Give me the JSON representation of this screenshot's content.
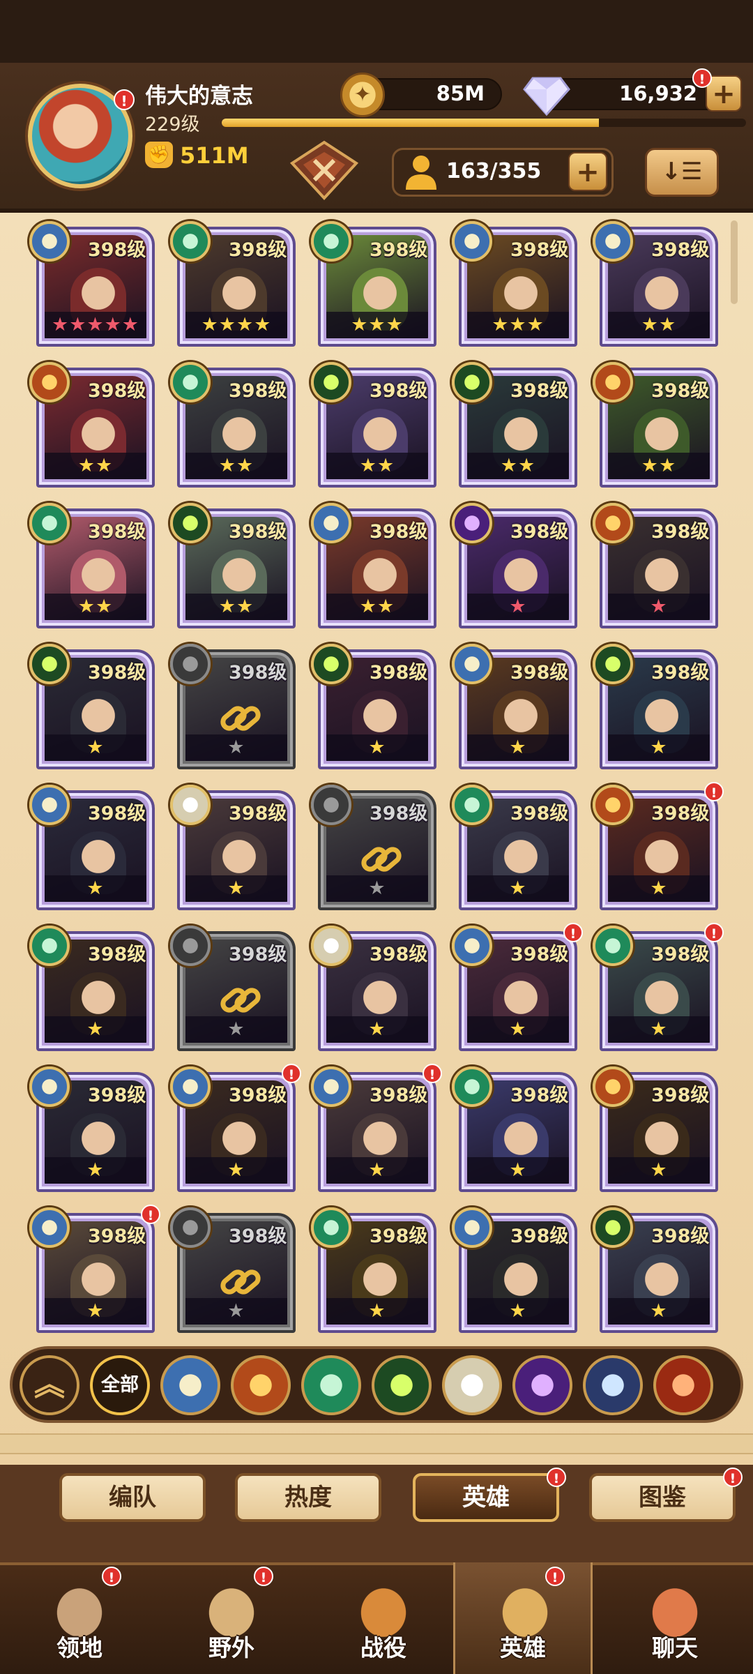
{
  "player": {
    "name": "伟大的意志",
    "level": "229级",
    "power": "511M",
    "xp_progress": 0.72
  },
  "resources": {
    "gold": "85M",
    "diamonds": "16,932",
    "plus_label": "+"
  },
  "roster": {
    "slots": "163/355",
    "plus_label": "+",
    "sort_label": "↓☰"
  },
  "colors": {
    "panel_bg": "#f3dfb9",
    "card_frame": "#5e4b8e",
    "badge_red": "#e0312b",
    "gold_text": "#ffcf3a"
  },
  "heroes": [
    {
      "level": "398级",
      "stars": "★★★★★",
      "star_color": "#f05a6c",
      "faction": "lightbearer",
      "portrait": "#7a2b2b",
      "locked": false,
      "alert": false
    },
    {
      "level": "398级",
      "stars": "★★★★",
      "star_color": "#ffd54a",
      "faction": "wilder",
      "portrait": "#4d3a2c",
      "locked": false,
      "alert": false
    },
    {
      "level": "398级",
      "stars": "★★★",
      "star_color": "#ffd54a",
      "faction": "wilder",
      "portrait": "#6b8a3a",
      "locked": false,
      "alert": false
    },
    {
      "level": "398级",
      "stars": "★★★",
      "star_color": "#ffd54a",
      "faction": "lightbearer",
      "portrait": "#6b4a22",
      "locked": false,
      "alert": false
    },
    {
      "level": "398级",
      "stars": "★★",
      "star_color": "#ffd54a",
      "faction": "lightbearer",
      "portrait": "#4a3a5a",
      "locked": false,
      "alert": false
    },
    {
      "level": "398级",
      "stars": "★★",
      "star_color": "#ffd54a",
      "faction": "mauler",
      "portrait": "#7a2a30",
      "locked": false,
      "alert": false
    },
    {
      "level": "398级",
      "stars": "★★",
      "star_color": "#ffd54a",
      "faction": "wilder",
      "portrait": "#3c4040",
      "locked": false,
      "alert": false
    },
    {
      "level": "398级",
      "stars": "★★",
      "star_color": "#ffd54a",
      "faction": "graveborn",
      "portrait": "#4b3c6a",
      "locked": false,
      "alert": false
    },
    {
      "level": "398级",
      "stars": "★★",
      "star_color": "#ffd54a",
      "faction": "graveborn",
      "portrait": "#2a3a3a",
      "locked": false,
      "alert": false
    },
    {
      "level": "398级",
      "stars": "★★",
      "star_color": "#ffd54a",
      "faction": "mauler",
      "portrait": "#3e5a2a",
      "locked": false,
      "alert": false
    },
    {
      "level": "398级",
      "stars": "★★",
      "star_color": "#ffd54a",
      "faction": "wilder",
      "portrait": "#b05a6a",
      "locked": false,
      "alert": false
    },
    {
      "level": "398级",
      "stars": "★★",
      "star_color": "#ffd54a",
      "faction": "graveborn",
      "portrait": "#5a6a5a",
      "locked": false,
      "alert": false
    },
    {
      "level": "398级",
      "stars": "★★",
      "star_color": "#ffd54a",
      "faction": "lightbearer",
      "portrait": "#7a3a2a",
      "locked": false,
      "alert": false
    },
    {
      "level": "398级",
      "stars": "★",
      "star_color": "#f05a6c",
      "faction": "hypogean",
      "portrait": "#4a2a6a",
      "locked": false,
      "alert": false
    },
    {
      "level": "398级",
      "stars": "★",
      "star_color": "#f05a6c",
      "faction": "mauler",
      "portrait": "#3a3030",
      "locked": false,
      "alert": false
    },
    {
      "level": "398级",
      "stars": "★",
      "star_color": "#ffd54a",
      "faction": "graveborn",
      "portrait": "#2a2a35",
      "locked": false,
      "alert": false
    },
    {
      "level": "398级",
      "stars": "★",
      "star_color": "#9a9a9a",
      "faction": "locked",
      "portrait": "#444444",
      "locked": true,
      "alert": false
    },
    {
      "level": "398级",
      "stars": "★",
      "star_color": "#ffd54a",
      "faction": "graveborn",
      "portrait": "#3a2030",
      "locked": false,
      "alert": false
    },
    {
      "level": "398级",
      "stars": "★",
      "star_color": "#ffd54a",
      "faction": "lightbearer",
      "portrait": "#5a3a20",
      "locked": false,
      "alert": false
    },
    {
      "level": "398级",
      "stars": "★",
      "star_color": "#ffd54a",
      "faction": "graveborn",
      "portrait": "#2a3a4a",
      "locked": false,
      "alert": false
    },
    {
      "level": "398级",
      "stars": "★",
      "star_color": "#ffd54a",
      "faction": "lightbearer",
      "portrait": "#2a2a3a",
      "locked": false,
      "alert": false
    },
    {
      "level": "398级",
      "stars": "★",
      "star_color": "#ffd54a",
      "faction": "celestial",
      "portrait": "#4a3a3a",
      "locked": false,
      "alert": false
    },
    {
      "level": "398级",
      "stars": "★",
      "star_color": "#9a9a9a",
      "faction": "locked",
      "portrait": "#444444",
      "locked": true,
      "alert": false
    },
    {
      "level": "398级",
      "stars": "★",
      "star_color": "#ffd54a",
      "faction": "wilder",
      "portrait": "#3a3a4a",
      "locked": false,
      "alert": false
    },
    {
      "level": "398级",
      "stars": "★",
      "star_color": "#ffd54a",
      "faction": "mauler",
      "portrait": "#5a2a20",
      "locked": false,
      "alert": true
    },
    {
      "level": "398级",
      "stars": "★",
      "star_color": "#ffd54a",
      "faction": "wilder",
      "portrait": "#3a2a20",
      "locked": false,
      "alert": false
    },
    {
      "level": "398级",
      "stars": "★",
      "star_color": "#9a9a9a",
      "faction": "locked",
      "portrait": "#444444",
      "locked": true,
      "alert": false
    },
    {
      "level": "398级",
      "stars": "★",
      "star_color": "#ffd54a",
      "faction": "celestial",
      "portrait": "#3a3040",
      "locked": false,
      "alert": false
    },
    {
      "level": "398级",
      "stars": "★",
      "star_color": "#ffd54a",
      "faction": "lightbearer",
      "portrait": "#4a2a3a",
      "locked": false,
      "alert": true
    },
    {
      "level": "398级",
      "stars": "★",
      "star_color": "#ffd54a",
      "faction": "wilder",
      "portrait": "#3a4a4a",
      "locked": false,
      "alert": true
    },
    {
      "level": "398级",
      "stars": "★",
      "star_color": "#ffd54a",
      "faction": "lightbearer",
      "portrait": "#2a2a35",
      "locked": false,
      "alert": false
    },
    {
      "level": "398级",
      "stars": "★",
      "star_color": "#ffd54a",
      "faction": "lightbearer",
      "portrait": "#3a2a20",
      "locked": false,
      "alert": true
    },
    {
      "level": "398级",
      "stars": "★",
      "star_color": "#ffd54a",
      "faction": "lightbearer",
      "portrait": "#4a3a3a",
      "locked": false,
      "alert": true
    },
    {
      "level": "398级",
      "stars": "★",
      "star_color": "#ffd54a",
      "faction": "wilder",
      "portrait": "#3a3a6a",
      "locked": false,
      "alert": false
    },
    {
      "level": "398级",
      "stars": "★",
      "star_color": "#ffd54a",
      "faction": "mauler",
      "portrait": "#3a2a1a",
      "locked": false,
      "alert": false
    },
    {
      "level": "398级",
      "stars": "★",
      "star_color": "#ffd54a",
      "faction": "lightbearer",
      "portrait": "#5a4a3a",
      "locked": false,
      "alert": true
    },
    {
      "level": "398级",
      "stars": "★",
      "star_color": "#9a9a9a",
      "faction": "locked",
      "portrait": "#444444",
      "locked": true,
      "alert": false
    },
    {
      "level": "398级",
      "stars": "★",
      "star_color": "#ffd54a",
      "faction": "wilder",
      "portrait": "#4a3a1a",
      "locked": false,
      "alert": false
    },
    {
      "level": "398级",
      "stars": "★",
      "star_color": "#ffd54a",
      "faction": "lightbearer",
      "portrait": "#2a2a2a",
      "locked": false,
      "alert": false
    },
    {
      "level": "398级",
      "stars": "★",
      "star_color": "#ffd54a",
      "faction": "graveborn",
      "portrait": "#3a4050",
      "locked": false,
      "alert": false
    }
  ],
  "filters": {
    "all_label": "全部",
    "items": [
      "rank-up",
      "all",
      "lightbearer",
      "mauler",
      "wilder",
      "graveborn",
      "celestial",
      "hypogean",
      "dimensional",
      "dragon"
    ]
  },
  "tabs": [
    {
      "label": "编队",
      "active": false,
      "alert": false
    },
    {
      "label": "热度",
      "active": false,
      "alert": false
    },
    {
      "label": "英雄",
      "active": true,
      "alert": true
    },
    {
      "label": "图鉴",
      "active": false,
      "alert": true
    }
  ],
  "nav": [
    {
      "label": "领地",
      "icon": "castle-icon",
      "active": false,
      "alert": true
    },
    {
      "label": "野外",
      "icon": "map-scroll-icon",
      "active": false,
      "alert": true
    },
    {
      "label": "战役",
      "icon": "sword-crest-icon",
      "active": false,
      "alert": false
    },
    {
      "label": "英雄",
      "icon": "helmet-icon",
      "active": true,
      "alert": true
    },
    {
      "label": "聊天",
      "icon": "chat-bubble-icon",
      "active": false,
      "alert": false
    }
  ]
}
